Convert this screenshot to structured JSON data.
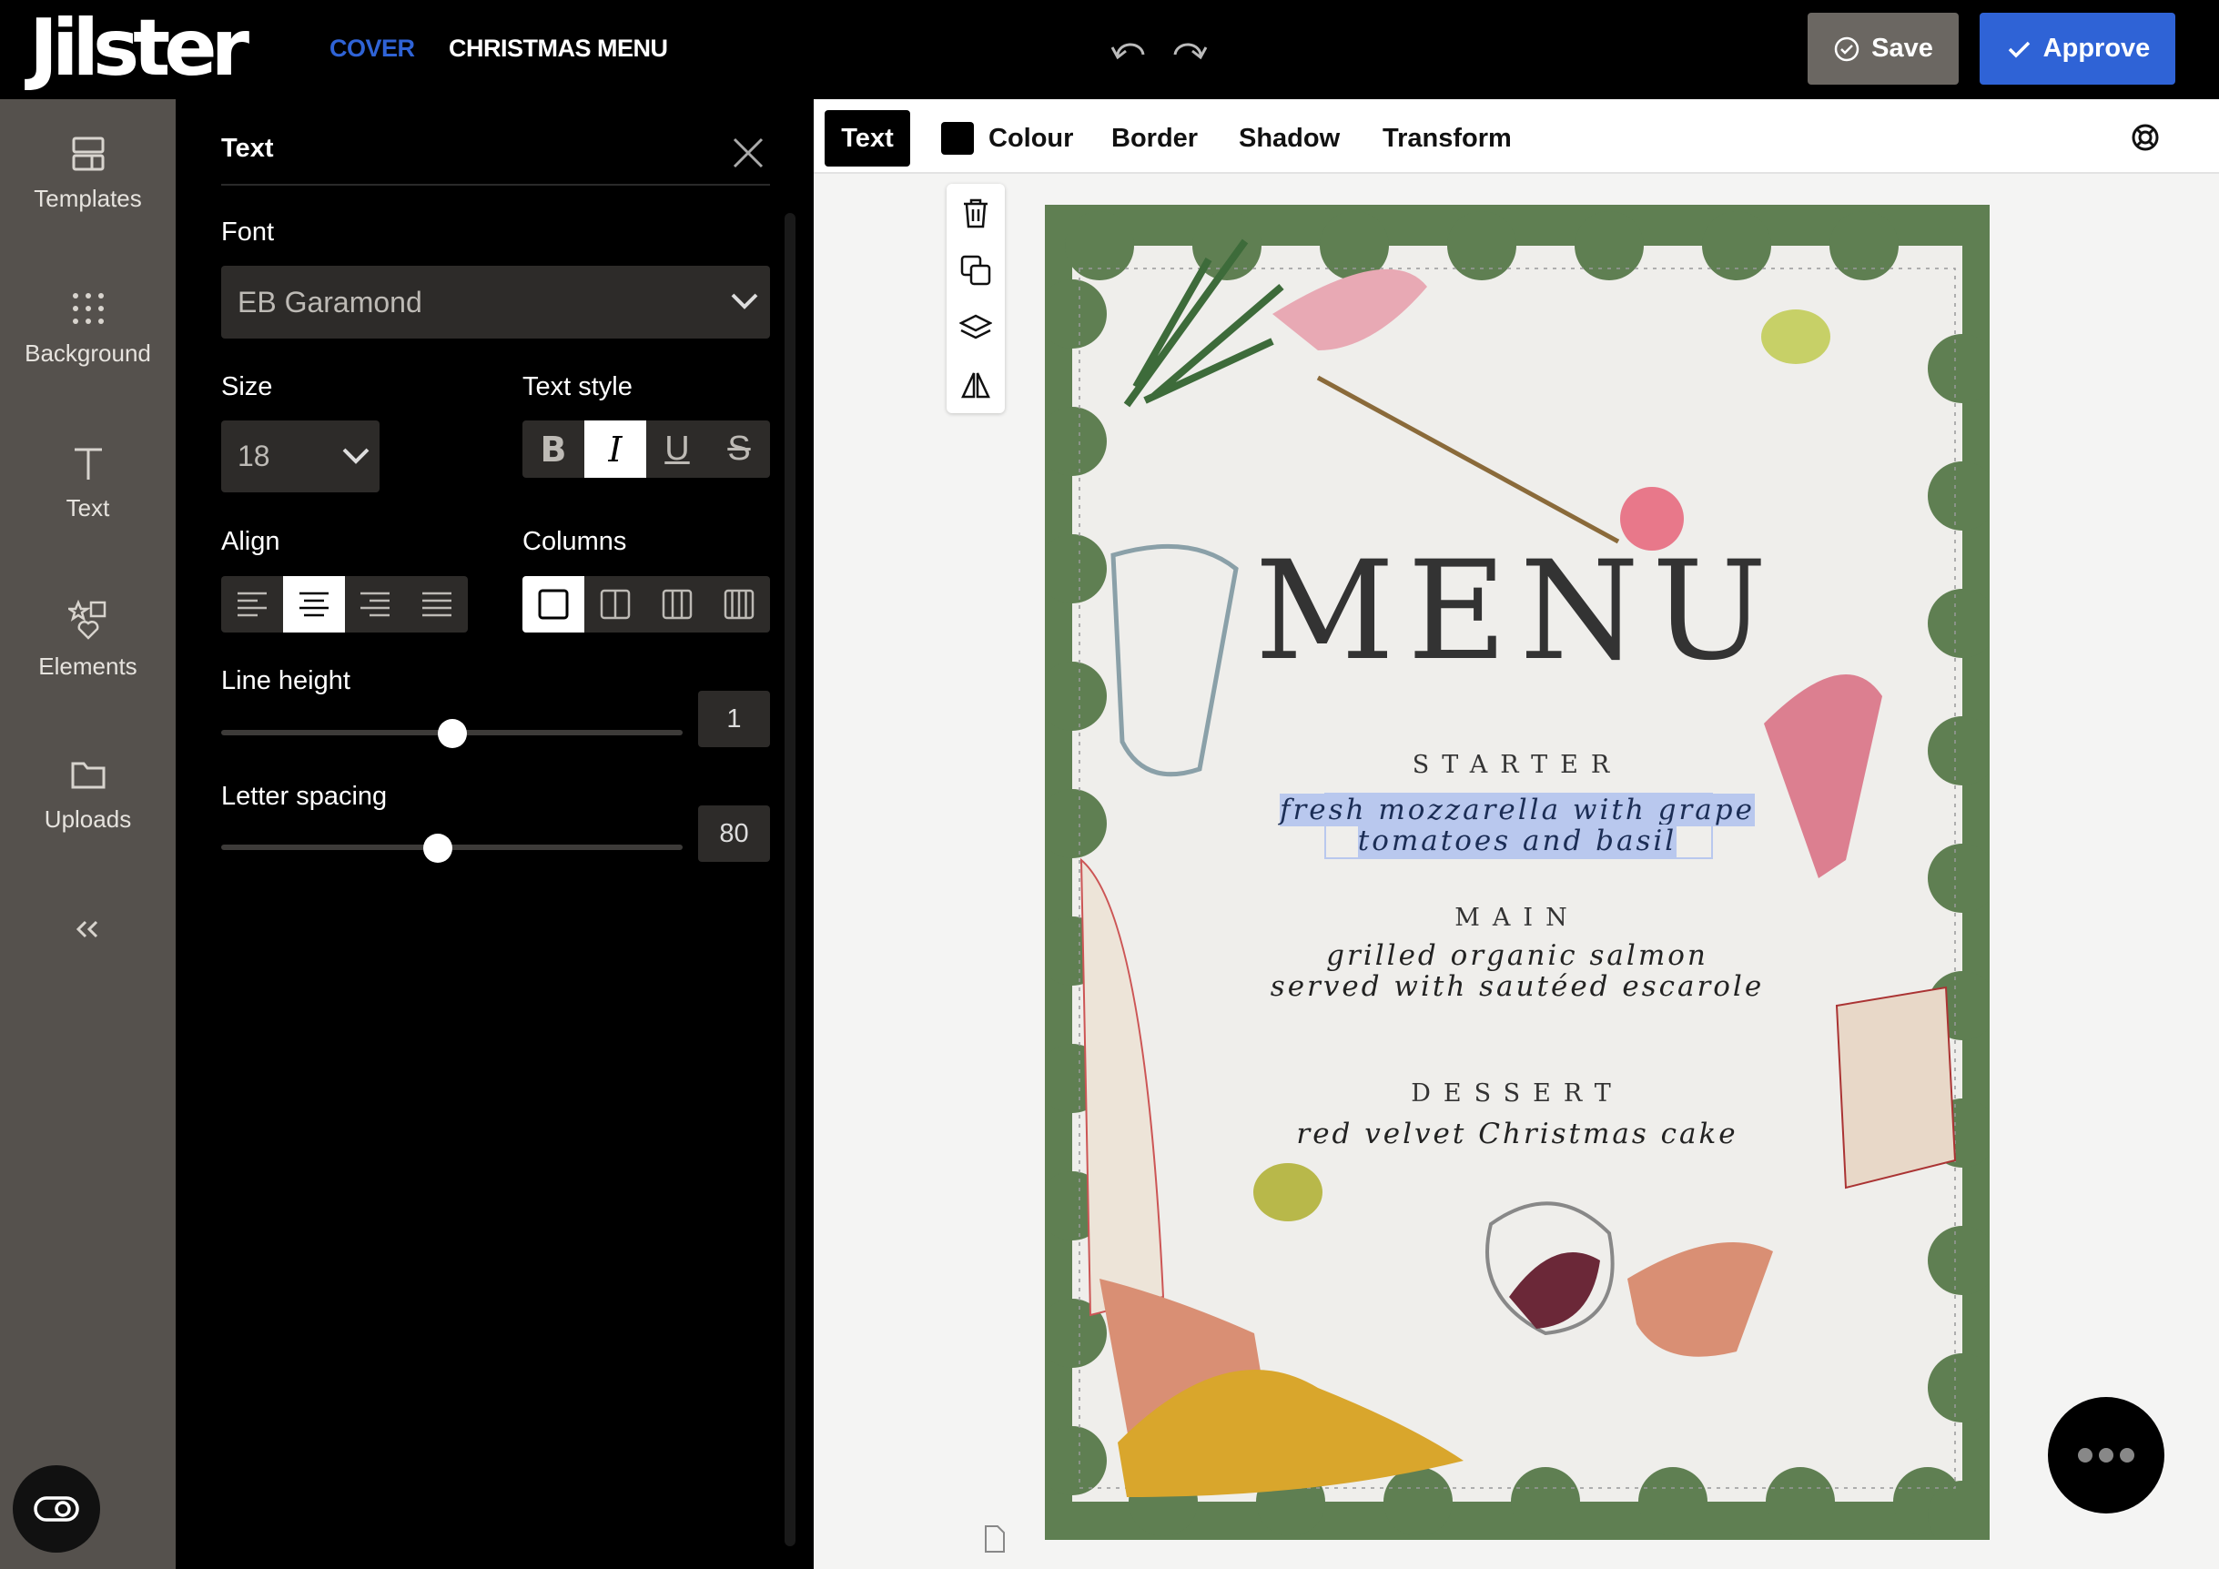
{
  "header": {
    "logo": "Jilster",
    "breadcrumb_cover": "COVER",
    "breadcrumb_title": "CHRISTMAS MENU",
    "save_label": "Save",
    "approve_label": "Approve",
    "accent": "#2f63d6"
  },
  "rail": {
    "items": [
      {
        "label": "Templates",
        "icon": "templates-icon"
      },
      {
        "label": "Background",
        "icon": "grid-dots-icon"
      },
      {
        "label": "Text",
        "icon": "text-icon"
      },
      {
        "label": "Elements",
        "icon": "elements-icon"
      },
      {
        "label": "Uploads",
        "icon": "folder-icon"
      }
    ]
  },
  "panel": {
    "title": "Text",
    "font_label": "Font",
    "font_value": "EB Garamond",
    "size_label": "Size",
    "size_value": "18",
    "text_style_label": "Text style",
    "style_buttons": [
      {
        "glyph": "B",
        "active": false
      },
      {
        "glyph": "I",
        "active": true
      },
      {
        "glyph": "U",
        "active": false
      },
      {
        "glyph": "S",
        "active": false
      }
    ],
    "align_label": "Align",
    "align_selected": "center",
    "columns_label": "Columns",
    "columns_selected": 1,
    "line_height_label": "Line height",
    "line_height_value": "1",
    "line_height_fraction": 0.5,
    "letter_spacing_label": "Letter spacing",
    "letter_spacing_value": "80",
    "letter_spacing_fraction": 0.47
  },
  "toolbar": {
    "tabs": [
      "Text",
      "Colour",
      "Border",
      "Shadow",
      "Transform"
    ],
    "colour_swatch": "#000000"
  },
  "menu": {
    "title": "MENU",
    "starter_heading": "STARTER",
    "starter_line1": "fresh mozzarella with grape",
    "starter_line2": "tomatoes and basil",
    "main_heading": "MAIN",
    "main_line1": "grilled organic salmon",
    "main_line2": "served with sautéed escarole",
    "dessert_heading": "DESSERT",
    "dessert_line1": "red velvet Christmas cake"
  }
}
